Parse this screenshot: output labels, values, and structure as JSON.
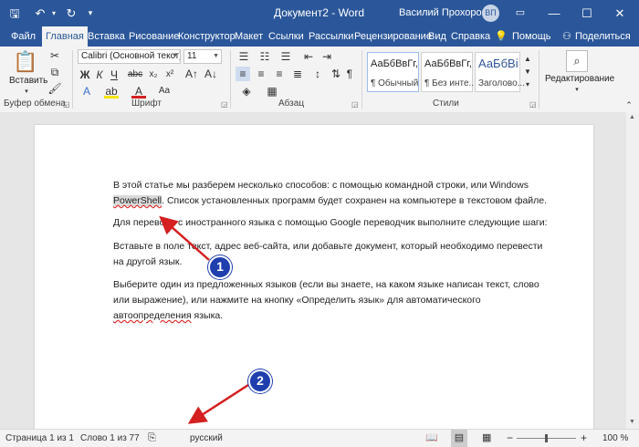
{
  "titlebar": {
    "doc_title": "Документ2 - Word",
    "user_name": "Василий Прохоров",
    "avatar_initials": "ВП"
  },
  "tabs": [
    {
      "label": "Файл"
    },
    {
      "label": "Главная"
    },
    {
      "label": "Вставка"
    },
    {
      "label": "Рисование"
    },
    {
      "label": "Конструктор"
    },
    {
      "label": "Макет"
    },
    {
      "label": "Ссылки"
    },
    {
      "label": "Рассылки"
    },
    {
      "label": "Рецензирование"
    },
    {
      "label": "Вид"
    },
    {
      "label": "Справка"
    },
    {
      "label": "Помощь"
    },
    {
      "label": "Поделиться"
    }
  ],
  "ribbon": {
    "paste_label": "Вставить",
    "clipboard_label": "Буфер обмена",
    "font_name": "Calibri (Основной текст)",
    "font_size": "11",
    "font_label": "Шрифт",
    "paragraph_label": "Абзац",
    "styles_label": "Стили",
    "editing_label": "Редактирование",
    "styles": [
      {
        "sample": "АаБбВвГг,",
        "name": "¶ Обычный"
      },
      {
        "sample": "АаБбВвГг,",
        "name": "¶ Без инте..."
      },
      {
        "sample": "АаБбВі",
        "name": "Заголово..."
      }
    ]
  },
  "document": {
    "p1_a": "В этой статье мы разберем несколько способов: с помощью командной строки, или Windows",
    "p1_word": "PowerShell",
    "p1_b": ". Список установленных программ будет сохранен на компьютере в текстовом файле.",
    "p2": "Для перевода с иностранного языка с помощью Google переводчик выполните следующие шаги:",
    "p3": "Вставьте в поле текст, адрес веб-сайта, или добавьте документ, который необходимо перевести на другой язык.",
    "p4_a": "Выберите один из предложенных языков (если вы знаете, на каком языке написан текст, слово или выражение), или нажмите на кнопку «Определить язык» для автоматического ",
    "p4_word": "автоопределения",
    "p4_b": " языка."
  },
  "annotations": {
    "badge1": "1",
    "badge2": "2"
  },
  "statusbar": {
    "page": "Страница 1 из 1",
    "words": "Слово 1 из 77",
    "language": "русский",
    "zoom": "100 %"
  },
  "colors": {
    "brand": "#2b579a",
    "badge": "#1f3fae",
    "arrow": "#d42020"
  }
}
